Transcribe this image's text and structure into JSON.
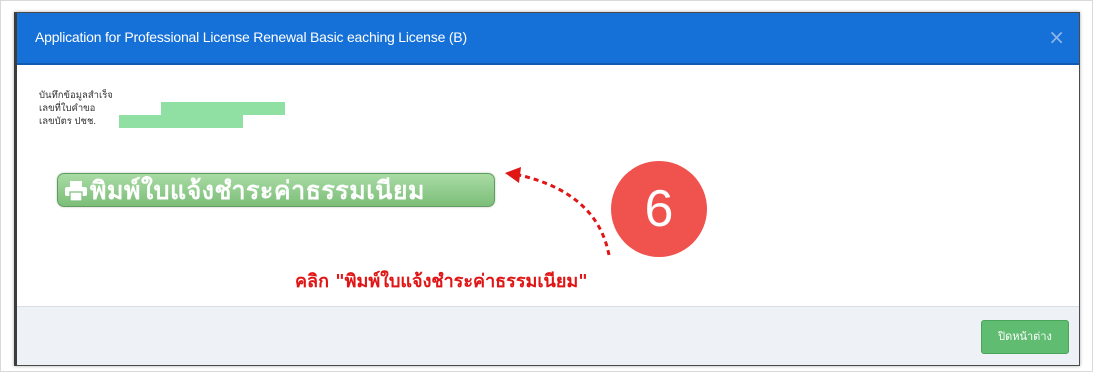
{
  "modal": {
    "title": "Application for Professional License Renewal  Basic  eaching License (B)",
    "close_symbol": "×"
  },
  "info": {
    "heading": "บันทึกข้อมูลสำเร็จ",
    "reference_label": "เลขที่ใบคำขอ",
    "id_label": "เลขบัตร ปชช."
  },
  "print_button": {
    "icon": "printer-icon",
    "label": "พิมพ์ใบแจ้งชำระค่าธรรมเนียม"
  },
  "annotation": {
    "step_number": "6",
    "instruction": "คลิก \"พิมพ์ใบแจ้งชำระค่าธรรมเนียม\"",
    "badge_color": "#f0524e",
    "instruction_color": "#e01515"
  },
  "footer": {
    "close_label": "ปิดหน้าต่าง"
  },
  "colors": {
    "header": "#1570d8",
    "print_button": "#8ccc87",
    "close_button": "#5fbc70",
    "masked_value": "#8fe0a2"
  }
}
